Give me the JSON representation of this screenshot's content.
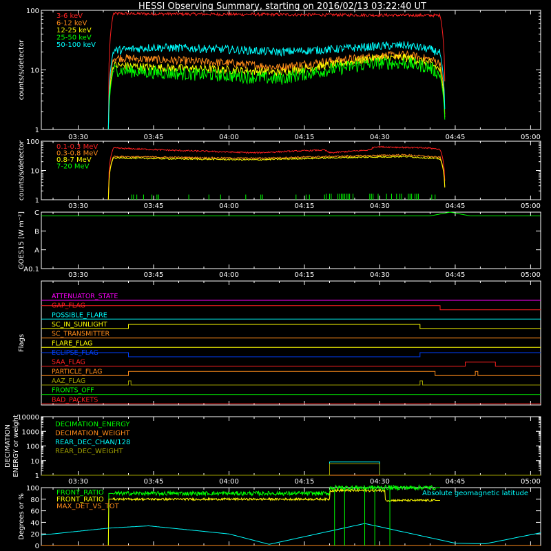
{
  "title": "HESSI Observing Summary, starting on 2016/02/13 03:22:40 UT",
  "colors": {
    "background": "#000000",
    "axes": "#ffffff",
    "red": "#ff2020",
    "orange": "#ff8c1a",
    "yellow": "#ffff00",
    "green": "#00ff00",
    "cyan": "#00ffff",
    "blue": "#0040ff",
    "magenta": "#ff00ff",
    "olive": "#a0a000"
  },
  "time_axis": {
    "start": "03:22:40",
    "end": "05:02:00",
    "tick_labels": [
      "03:30",
      "03:45",
      "04:00",
      "04:15",
      "04:30",
      "04:45",
      "05:00"
    ]
  },
  "chart_data": [
    {
      "id": "lowe",
      "type": "line",
      "title": "HESSI Observing Summary, starting on 2016/02/13 03:22:40 UT",
      "ylabel": "counts/s/detector",
      "yscale": "log",
      "ylim": [
        1,
        100
      ],
      "ytick_labels": [
        "1",
        "10",
        "100"
      ],
      "legend": "top-left",
      "series": [
        {
          "name": "3-6 keV",
          "color": "red",
          "times": [
            "03:36",
            "03:37",
            "04:42",
            "04:43"
          ],
          "values": [
            1,
            88,
            82,
            1
          ]
        },
        {
          "name": "6-12 keV",
          "color": "orange",
          "times": [
            "03:36",
            "03:37",
            "03:45",
            "04:00",
            "04:10",
            "04:20",
            "04:30",
            "04:35",
            "04:40",
            "04:42",
            "04:43"
          ],
          "values": [
            1,
            16,
            15,
            13,
            11,
            14,
            17,
            18,
            15,
            13,
            1
          ]
        },
        {
          "name": "12-25 keV",
          "color": "yellow",
          "times": [
            "03:36",
            "03:37",
            "03:45",
            "04:00",
            "04:10",
            "04:20",
            "04:30",
            "04:35",
            "04:40",
            "04:42",
            "04:43"
          ],
          "values": [
            1,
            12,
            11,
            10,
            9,
            12,
            16,
            16,
            13,
            10,
            1
          ]
        },
        {
          "name": "25-50 keV",
          "color": "green",
          "times": [
            "03:36",
            "03:37",
            "03:45",
            "04:00",
            "04:10",
            "04:20",
            "04:30",
            "04:35",
            "04:40",
            "04:42",
            "04:43"
          ],
          "values": [
            1,
            10,
            9,
            8,
            7,
            10,
            13,
            13,
            11,
            8,
            1
          ]
        },
        {
          "name": "50-100 keV",
          "color": "cyan",
          "times": [
            "03:36",
            "03:37",
            "03:45",
            "04:00",
            "04:10",
            "04:20",
            "04:30",
            "04:35",
            "04:40",
            "04:42",
            "04:43"
          ],
          "values": [
            1,
            21,
            24,
            22,
            20,
            22,
            25,
            26,
            22,
            19,
            1
          ]
        }
      ]
    },
    {
      "id": "highe",
      "type": "line",
      "ylabel": "counts/s/detector",
      "yscale": "log",
      "ylim": [
        1,
        100
      ],
      "ytick_labels": [
        "1",
        "10",
        "100"
      ],
      "legend": "top-left",
      "series": [
        {
          "name": "0.1-0.3 MeV",
          "color": "red",
          "times": [
            "03:36",
            "03:37",
            "03:50",
            "04:05",
            "04:19",
            "04:20",
            "04:28",
            "04:29",
            "04:40",
            "04:42",
            "04:43"
          ],
          "values": [
            1,
            58,
            48,
            40,
            50,
            40,
            50,
            65,
            58,
            52,
            1
          ]
        },
        {
          "name": "0.3-0.8 MeV",
          "color": "orange",
          "times": [
            "03:36",
            "03:37",
            "03:50",
            "04:05",
            "04:20",
            "04:35",
            "04:42",
            "04:43"
          ],
          "values": [
            1,
            30,
            28,
            26,
            30,
            34,
            28,
            1
          ]
        },
        {
          "name": "0.8-7 MeV",
          "color": "yellow",
          "times": [
            "03:36",
            "03:37",
            "03:50",
            "04:05",
            "04:20",
            "04:35",
            "04:42",
            "04:43"
          ],
          "values": [
            1,
            27,
            25,
            23,
            27,
            30,
            25,
            1
          ]
        },
        {
          "name": "7-20 MeV",
          "color": "green",
          "times": [
            "03:36",
            "04:42"
          ],
          "values": [
            1,
            1
          ]
        }
      ]
    },
    {
      "id": "goes",
      "type": "line",
      "ylabel": "GOES15 [W m⁻²]",
      "ytick_labels": [
        "A0.1",
        "A",
        "B",
        "C"
      ],
      "series": [
        {
          "name": "GOES15",
          "color": "green",
          "times": [
            "03:22:40",
            "04:40",
            "04:44",
            "04:48",
            "05:02"
          ],
          "values": [
            2.8,
            2.8,
            3.0,
            2.8,
            2.8
          ]
        }
      ]
    },
    {
      "id": "flags",
      "type": "line",
      "ylabel": "Flags",
      "series": [
        {
          "name": "ATTENUATOR_STATE",
          "color": "magenta",
          "times": [
            "03:22:40",
            "05:02"
          ],
          "values": [
            0,
            0
          ]
        },
        {
          "name": "GAP_FLAG",
          "color": "red",
          "times": [
            "03:22:40",
            "04:42",
            "04:42",
            "05:02"
          ],
          "values": [
            1,
            1,
            0,
            0
          ]
        },
        {
          "name": "POSSIBLE_FLARE",
          "color": "cyan",
          "times": [
            "03:22:40",
            "05:02"
          ],
          "values": [
            0,
            0
          ]
        },
        {
          "name": "SC_IN_SUNLIGHT",
          "color": "yellow",
          "times": [
            "03:22:40",
            "03:40",
            "03:40",
            "04:38",
            "04:38",
            "05:02"
          ],
          "values": [
            0,
            0,
            1,
            1,
            0,
            0
          ]
        },
        {
          "name": "SC_TRANSMITTER",
          "color": "orange",
          "times": [
            "03:22:40",
            "05:02"
          ],
          "values": [
            0,
            0
          ]
        },
        {
          "name": "FLARE_FLAG",
          "color": "yellow",
          "times": [
            "03:22:40",
            "05:02"
          ],
          "values": [
            0,
            0
          ]
        },
        {
          "name": "ECLIPSE_FLAG",
          "color": "blue",
          "times": [
            "03:22:40",
            "03:40",
            "03:40",
            "04:38",
            "04:38",
            "05:02"
          ],
          "values": [
            1,
            1,
            0,
            0,
            1,
            1
          ]
        },
        {
          "name": "SAA_FLAG",
          "color": "red",
          "times": [
            "03:22:40",
            "04:47",
            "04:47",
            "04:53",
            "04:53",
            "05:02"
          ],
          "values": [
            0,
            0,
            1,
            1,
            0,
            0
          ]
        },
        {
          "name": "PARTICLE_FLAG",
          "color": "orange",
          "times": [
            "03:22:40",
            "03:40",
            "03:40",
            "04:41",
            "04:41",
            "04:49",
            "04:49",
            "04:49:30",
            "04:49:30",
            "05:02"
          ],
          "values": [
            0,
            0,
            1,
            1,
            0,
            0,
            1,
            1,
            0,
            0
          ]
        },
        {
          "name": "AAZ_FLAG",
          "color": "olive",
          "times": [
            "03:22:40",
            "03:40",
            "03:40",
            "03:40:30",
            "03:40:30",
            "04:38",
            "04:38",
            "04:38:30",
            "04:38:30",
            "05:02"
          ],
          "values": [
            0,
            0,
            1,
            1,
            0,
            0,
            1,
            1,
            0,
            0
          ]
        },
        {
          "name": "FRONTS_OFF",
          "color": "green",
          "times": [
            "03:22:40",
            "05:02"
          ],
          "values": [
            0,
            0
          ]
        },
        {
          "name": "BAD_PACKETS",
          "color": "red",
          "times": [
            "03:22:40",
            "05:02"
          ],
          "values": [
            0,
            0
          ]
        }
      ]
    },
    {
      "id": "decim",
      "type": "line",
      "ylabel": "DECIMATION ENERGY or weight",
      "yscale": "log",
      "ylim": [
        1,
        10000
      ],
      "ytick_labels": [
        "1",
        "10",
        "100",
        "1000",
        "10000"
      ],
      "legend": "top-left",
      "series": [
        {
          "name": "DECIMATION_ENERGY",
          "color": "green",
          "times": [
            "03:22:40",
            "05:02"
          ],
          "values": [
            1,
            1
          ]
        },
        {
          "name": "DECIMATION_WEIGHT",
          "color": "orange",
          "times": [
            "03:22:40",
            "05:02"
          ],
          "values": [
            1,
            1
          ]
        },
        {
          "name": "REAR_DEC_CHAN/128",
          "color": "cyan",
          "times": [
            "03:22:40",
            "04:20",
            "04:20",
            "04:30",
            "04:30",
            "05:02"
          ],
          "values": [
            1,
            1,
            8,
            8,
            1,
            1
          ]
        },
        {
          "name": "REAR_DEC_WEIGHT",
          "color": "olive",
          "times": [
            "03:22:40",
            "04:20",
            "04:20",
            "04:30",
            "04:30",
            "05:02"
          ],
          "values": [
            1,
            1,
            6,
            6,
            1,
            1
          ]
        }
      ]
    },
    {
      "id": "ratio",
      "type": "line",
      "ylabel": "Degrees or %",
      "ylim": [
        0,
        100
      ],
      "ytick_labels": [
        "0",
        "20",
        "40",
        "60",
        "80",
        "100"
      ],
      "legend": "top-left",
      "annotations": [
        "Absolute geomagnetic latitude"
      ],
      "series": [
        {
          "name": "FRONT_RATIO",
          "color": "green",
          "times": [
            "03:36",
            "03:36",
            "04:20",
            "04:20",
            "04:42",
            "04:42"
          ],
          "values": [
            0,
            90,
            90,
            100,
            100,
            0
          ]
        },
        {
          "name": "FRONT_RATIO",
          "color": "yellow",
          "times": [
            "03:36",
            "03:36",
            "04:20",
            "04:20",
            "04:31",
            "04:31",
            "04:42",
            "04:42"
          ],
          "values": [
            0,
            80,
            80,
            95,
            95,
            78,
            78,
            0
          ]
        },
        {
          "name": "MAX_DET_VS_TOT",
          "color": "orange",
          "times": [
            "03:22:40",
            "05:02"
          ],
          "values": [
            0,
            0
          ]
        },
        {
          "name": "Absolute geomagnetic latitude",
          "color": "cyan",
          "times": [
            "03:22:40",
            "03:36",
            "03:44",
            "04:00",
            "04:08",
            "04:27",
            "04:45",
            "04:51",
            "05:02"
          ],
          "values": [
            18,
            30,
            34,
            20,
            2,
            38,
            4,
            3,
            22
          ]
        }
      ]
    }
  ]
}
